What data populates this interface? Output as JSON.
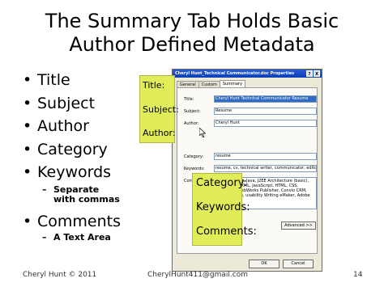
{
  "slide": {
    "title_line1": "The Summary Tab Holds Basic",
    "title_line2": "Author Defined Metadata"
  },
  "bullets": [
    {
      "label": "Title"
    },
    {
      "label": "Subject"
    },
    {
      "label": "Author"
    },
    {
      "label": "Category"
    },
    {
      "label": "Keywords"
    },
    {
      "sub_line1": "Separate",
      "sub_line2": "with commas"
    },
    {
      "label": "Comments"
    },
    {
      "sub_line1": "A Text Area"
    }
  ],
  "bullet_glyph": "•",
  "sub_glyph": "–",
  "dialog": {
    "title": "Cheryl Hunt_Technical Communicator.doc Properties",
    "help_btn": "?",
    "close_btn": "X",
    "tabs": [
      "General",
      "Custom",
      "Summary"
    ],
    "active_tab": "Summary",
    "fields": {
      "title": {
        "label": "Title:",
        "value": "Cheryl Hunt Technical Communicator Resume"
      },
      "subject": {
        "label": "Subject:",
        "value": "Resume"
      },
      "author": {
        "label": "Author:",
        "value": "Cheryl Hunt"
      },
      "category": {
        "label": "Category:",
        "value": "resume"
      },
      "keywords": {
        "label": "Keywords:",
        "value": "resume, cv, technical writer, communicator, editor, c"
      },
      "comments": {
        "label": "Comments:",
        "value": "Written About: Java, J2EE Architecture (basic), SQL (basic), XML, JavaScript, HTML, CSS, RoboHelp, WebWorks Publisher, Convio CRM, ATG intranets, usability Writing eMaker, Adobe"
      }
    },
    "advanced_btn": "Advanced >>",
    "ok_btn": "OK",
    "cancel_btn": "Cancel"
  },
  "callouts": {
    "top": [
      "Title:",
      "Subject:",
      "Author:"
    ],
    "bottom": [
      "Category:",
      "Keywords:",
      "Comments:"
    ]
  },
  "footer": {
    "left": "Cheryl Hunt © 2011",
    "center": "CherylHunt411@gmail.com",
    "right": "14"
  },
  "colors": {
    "callout": "#e0ec58",
    "titlebar": "#0a3fb5",
    "dialog_bg": "#ece9d8"
  }
}
